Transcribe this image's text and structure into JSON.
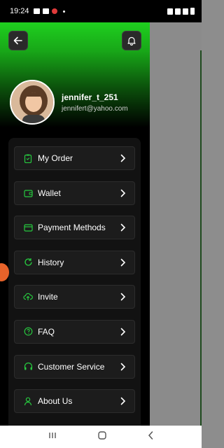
{
  "status_bar": {
    "time": "19:24",
    "battery": ""
  },
  "colors": {
    "accent": "#22cc22",
    "icon_green": "#27c93f"
  },
  "header": {
    "back_icon": "arrow-left-icon",
    "notification_icon": "bell-icon"
  },
  "profile": {
    "username": "jennifer_t_251",
    "email": "jennifert@yahoo.com"
  },
  "menu": {
    "items": [
      {
        "label": "My Order",
        "icon": "clipboard-icon"
      },
      {
        "label": "Wallet",
        "icon": "wallet-icon"
      },
      {
        "label": "Payment Methods",
        "icon": "credit-card-icon"
      },
      {
        "label": "History",
        "icon": "refresh-icon"
      },
      {
        "label": "Invite",
        "icon": "cloud-upload-icon"
      },
      {
        "label": "FAQ",
        "icon": "question-circle-icon"
      },
      {
        "label": "Customer Service",
        "icon": "headphones-icon"
      },
      {
        "label": "About Us",
        "icon": "person-icon"
      }
    ]
  }
}
